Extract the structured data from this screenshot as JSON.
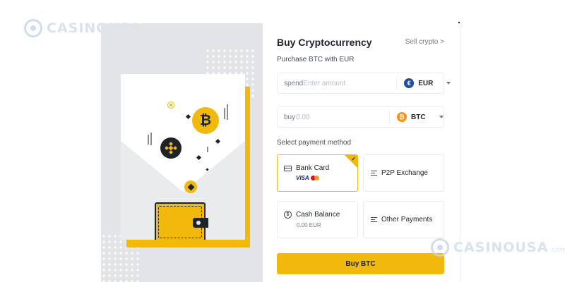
{
  "watermark": {
    "brand": "CASINOUSA",
    "domain": ".com"
  },
  "header": {
    "title": "Buy Cryptocurrency",
    "sell_link": "Sell crypto >",
    "subtitle": "Purchase BTC with EUR"
  },
  "spend": {
    "label": "spend",
    "placeholder": "Enter amount",
    "currency": "EUR",
    "currency_icon": "euro-icon"
  },
  "buy": {
    "label": "buy",
    "value": "0.00",
    "currency": "BTC",
    "currency_icon": "bitcoin-icon"
  },
  "payment": {
    "label": "Select payment method",
    "methods": [
      {
        "label": "Bank Card",
        "icon": "card-icon",
        "brands": "VISA",
        "selected": true
      },
      {
        "label": "P2P Exchange",
        "icon": "list-icon",
        "selected": false
      },
      {
        "label": "Cash Balance",
        "icon": "cash-icon",
        "sub": "0.00 EUR",
        "selected": false
      },
      {
        "label": "Other Payments",
        "icon": "list-icon",
        "selected": false
      }
    ]
  },
  "action": {
    "label": "Buy BTC"
  },
  "colors": {
    "accent": "#f0b90b",
    "text": "#1e2329",
    "muted": "#707a8a",
    "border": "#eaecef"
  }
}
